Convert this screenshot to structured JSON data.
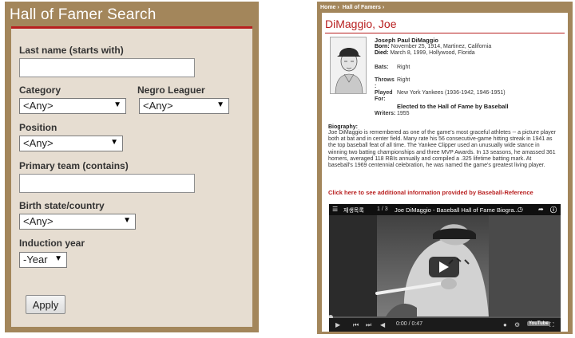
{
  "search": {
    "title": "Hall of Famer Search",
    "last_name_label": "Last name (starts with)",
    "last_name_value": "",
    "category_label": "Category",
    "category_value": "<Any>",
    "negro_leaguer_label": "Negro Leaguer",
    "negro_leaguer_value": "<Any>",
    "position_label": "Position",
    "position_value": "<Any>",
    "primary_team_label": "Primary team (contains)",
    "primary_team_value": "",
    "birth_state_label": "Birth state/country",
    "birth_state_value": "<Any>",
    "induction_year_label": "Induction year",
    "induction_year_value": "-Year",
    "apply_label": "Apply"
  },
  "detail": {
    "breadcrumb": [
      "Home ›",
      "Hall of Famers ›"
    ],
    "title": "DiMaggio, Joe",
    "full_name": "Joseph Paul DiMaggio",
    "born_label": "Born:",
    "born_value": "November 25, 1914, Martinez, California",
    "died_label": "Died:",
    "died_value": "March 8, 1999, Hollywood, Florida",
    "bats_label": "Bats:",
    "bats_value": "Right",
    "throws_label": "Throws",
    "throws_colon": ":",
    "throws_value": "Right",
    "played_label": "Played",
    "for_label": "For:",
    "played_value": "New York Yankees (1936-1942, 1946-1951)",
    "hof_text": "Elected to the Hall of Fame by Baseball",
    "writers_label": "Writers:",
    "writers_year": "1955",
    "bio_heading": "Biography:",
    "bio_text": "Joe DiMaggio is remembered as one of the game's most graceful athletes -- a picture player both at bat and in center field. Many rate his 56 consecutive-game hitting streak in 1941 as the top baseball feat of all time. The Yankee Clipper used an unusually wide stance in winning two batting championships and three MVP Awards. In 13 seasons, he amassed 361 homers, averaged 118 RBIs annually and compiled a .325 lifetime batting mark. At baseball's 1969 centennial celebration, he was named the game's greatest living player.",
    "bref_link": "Click here to see additional information provided by Baseball-Reference"
  },
  "video": {
    "playlist_icon": "playlist-icon",
    "playlist_label": "재생목록",
    "playlist_count": "1 / 3",
    "title": "Joe DiMaggio - Baseball Hall of Fame Biogra...",
    "time": "0:00 / 0:47",
    "logo": "YouTube",
    "progress_fraction": 0
  }
}
